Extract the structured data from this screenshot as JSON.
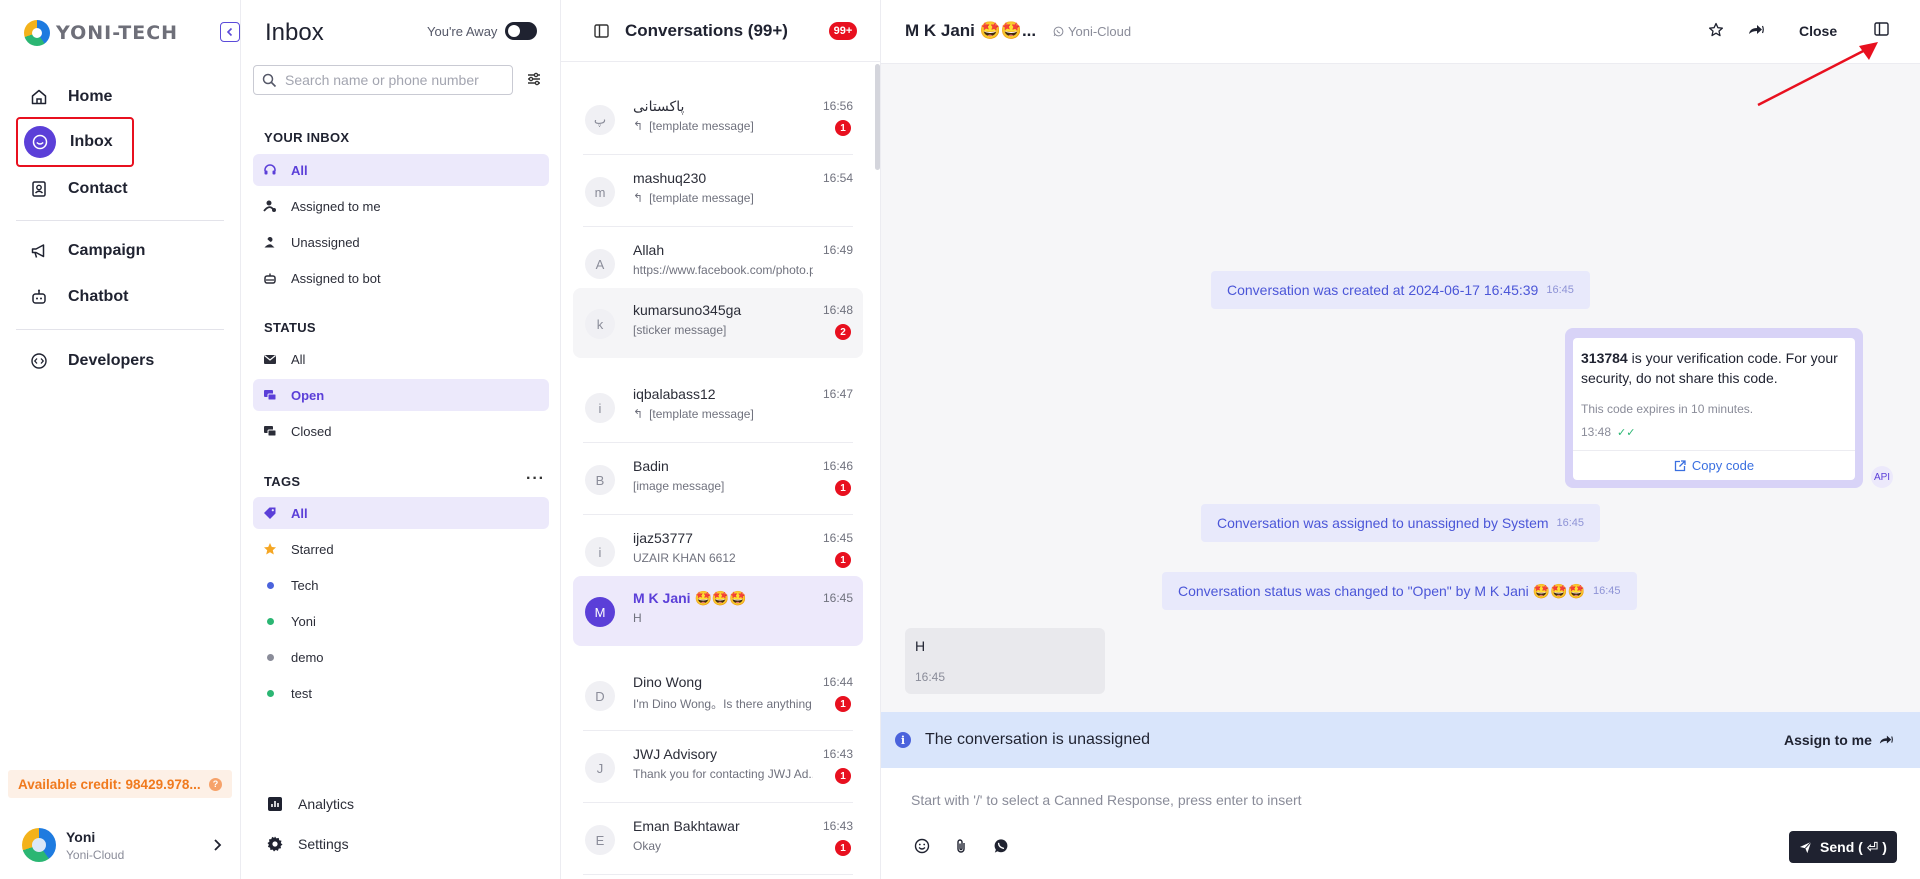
{
  "app": {
    "brand": "YONI-TECH"
  },
  "nav": {
    "items": [
      {
        "label": "Home",
        "icon": "home-icon"
      },
      {
        "label": "Inbox",
        "icon": "inbox-icon"
      },
      {
        "label": "Contact",
        "icon": "contact-icon"
      },
      {
        "label": "Campaign",
        "icon": "megaphone-icon"
      },
      {
        "label": "Chatbot",
        "icon": "robot-icon"
      },
      {
        "label": "Developers",
        "icon": "code-icon"
      }
    ],
    "credit": "Available credit: 98429.978...",
    "user": {
      "name": "Yoni",
      "org": "Yoni-Cloud"
    }
  },
  "inbox": {
    "title": "Inbox",
    "away_label": "You're Away",
    "search_placeholder": "Search name or phone number",
    "your_inbox_title": "YOUR INBOX",
    "your_inbox": [
      "All",
      "Assigned to me",
      "Unassigned",
      "Assigned to bot"
    ],
    "status_title": "STATUS",
    "status": [
      "All",
      "Open",
      "Closed"
    ],
    "tags_title": "TAGS",
    "tags": [
      {
        "label": "All"
      },
      {
        "label": "Starred",
        "color": "#f5a623"
      },
      {
        "label": "Tech",
        "color": "#4b63dc"
      },
      {
        "label": "Yoni",
        "color": "#2bb673"
      },
      {
        "label": "demo",
        "color": "#8a8c99"
      },
      {
        "label": "test",
        "color": "#2bb673"
      }
    ],
    "analytics": "Analytics",
    "settings": "Settings"
  },
  "conversations": {
    "title": "Conversations (99+)",
    "badge": "99+",
    "items": [
      {
        "initial": "پ",
        "name": "پاکستانی",
        "preview": "[template message]",
        "time": "16:56",
        "unread": "1",
        "reply": true
      },
      {
        "initial": "m",
        "name": "mashuq230",
        "preview": "[template message]",
        "time": "16:54",
        "unread": "",
        "reply": true
      },
      {
        "initial": "A",
        "name": "Allah",
        "preview": "https://www.facebook.com/photo.php?...",
        "time": "16:49",
        "unread": "",
        "reply": false
      },
      {
        "initial": "k",
        "name": "kumarsuno345ga",
        "preview": "[sticker message]",
        "time": "16:48",
        "unread": "2",
        "reply": false
      },
      {
        "initial": "i",
        "name": "iqbalabass12",
        "preview": "[template message]",
        "time": "16:47",
        "unread": "",
        "reply": true
      },
      {
        "initial": "B",
        "name": "Badin",
        "preview": "[image message]",
        "time": "16:46",
        "unread": "1",
        "reply": false
      },
      {
        "initial": "i",
        "name": "ijaz53777",
        "preview": "UZAIR KHAN 6612",
        "time": "16:45",
        "unread": "1",
        "reply": false
      },
      {
        "initial": "M",
        "name": "M K Jani 🤩🤩🤩",
        "preview": "H",
        "time": "16:45",
        "unread": "",
        "reply": false
      },
      {
        "initial": "D",
        "name": "Dino Wong",
        "preview": "I'm Dino Wong。Is there anything ...",
        "time": "16:44",
        "unread": "1",
        "reply": false
      },
      {
        "initial": "J",
        "name": "JWJ Advisory",
        "preview": "Thank you for contacting JWJ Ad...",
        "time": "16:43",
        "unread": "1",
        "reply": false
      },
      {
        "initial": "E",
        "name": "Eman Bakhtawar",
        "preview": "Okay",
        "time": "16:43",
        "unread": "1",
        "reply": false
      }
    ]
  },
  "chat": {
    "contact_name": "M K Jani 🤩🤩...",
    "source": "Yoni-Cloud",
    "close_label": "Close",
    "sys_created": "Conversation was created at 2024-06-17 16:45:39",
    "sys_created_time": "16:45",
    "template": {
      "code": "313784",
      "text": " is your verification code. For your security, do not share this code.",
      "footer": "This code expires in 10 minutes.",
      "time": "13:48",
      "button": "Copy code",
      "api": "API"
    },
    "sys_assigned": "Conversation was assigned to unassigned by System",
    "sys_assigned_time": "16:45",
    "sys_status": "Conversation status was changed to \"Open\" by M K Jani 🤩🤩🤩",
    "sys_status_time": "16:45",
    "incoming": {
      "text": "H",
      "time": "16:45"
    },
    "unassigned_text": "The conversation is unassigned",
    "assign_label": "Assign to me",
    "composer_placeholder": "Start with '/' to select a Canned Response, press enter to insert",
    "send_label": "Send ( ⏎ )"
  }
}
